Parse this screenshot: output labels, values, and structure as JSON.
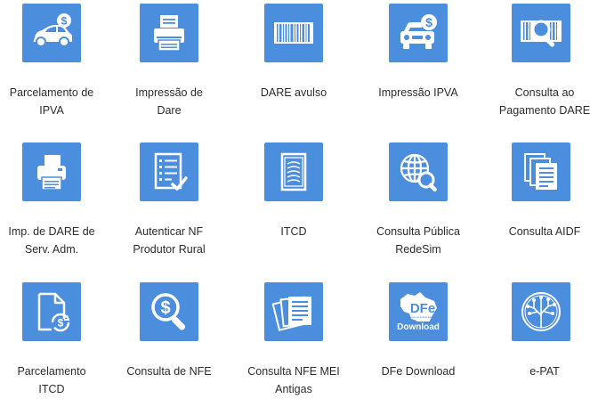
{
  "accent_color": "#4b8ede",
  "tiles": [
    {
      "label": "Parcelamento de\nIPVA",
      "icon": "car-dollar-icon"
    },
    {
      "label": "Impressão de\nDare",
      "icon": "printer-icon"
    },
    {
      "label": "DARE avulso",
      "icon": "barcode-icon"
    },
    {
      "label": "Impressão IPVA",
      "icon": "car-front-dollar-icon"
    },
    {
      "label": "Consulta ao\nPagamento DARE",
      "icon": "barcode-magnifier-icon"
    },
    {
      "label": "Imp. de DARE de\nServ. Adm.",
      "icon": "fax-printer-icon"
    },
    {
      "label": "Autenticar NF\nProdutor Rural",
      "icon": "checklist-document-icon"
    },
    {
      "label": "ITCD",
      "icon": "scroll-document-icon"
    },
    {
      "label": "Consulta Pública\nRedeSim",
      "icon": "globe-magnifier-icon"
    },
    {
      "label": "Consulta AIDF",
      "icon": "stacked-documents-icon"
    },
    {
      "label": "Parcelamento\nITCD",
      "icon": "document-dollar-cycle-icon"
    },
    {
      "label": "Consulta de NFE",
      "icon": "dollar-magnifier-icon"
    },
    {
      "label": "Consulta NFE MEI\nAntigas",
      "icon": "receipts-stack-icon"
    },
    {
      "label": "DFe Download",
      "icon": "dfe-brazil-map-icon",
      "badge_main": "DFe",
      "badge_sub": "Documento Fiscal Eletrônico",
      "badge_download": "Download"
    },
    {
      "label": "e-PAT",
      "icon": "circuit-tree-icon"
    }
  ]
}
